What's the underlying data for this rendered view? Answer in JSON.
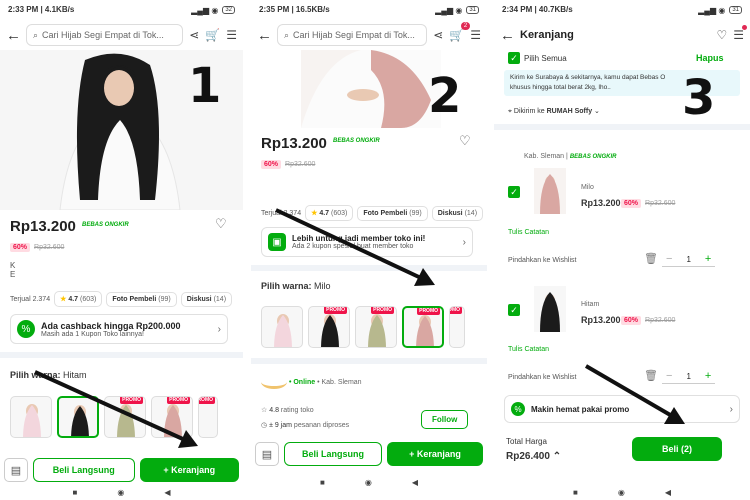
{
  "panels": [
    {
      "status": {
        "time": "2:33 PM",
        "speed": "4.1KB/s",
        "battery": "32"
      },
      "search_placeholder": "Cari Hijab Segi Empat di Tok...",
      "step_number": "1",
      "price": "Rp13.200",
      "shipping_badge": "BEBAS ONGKIR",
      "discount_pct": "60%",
      "old_price": "Rp32.600",
      "sold": "Terjual 2.374",
      "rating": "4.7",
      "rating_count": "(603)",
      "photo_chip": "Foto Pembeli",
      "photo_count": "(99)",
      "discussion_chip": "Diskusi",
      "discussion_count": "(14)",
      "cashback_title": "Ada cashback hingga Rp200.000",
      "cashback_sub": "Masih ada 1 Kupon Toko lainnya!",
      "variant_label": "Pilih warna:",
      "variant_value": "Hitam",
      "promo": "PROMO",
      "buy_now": "Beli Langsung",
      "add_cart": "+ Keranjang"
    },
    {
      "status": {
        "time": "2:35 PM",
        "speed": "16.5KB/s",
        "battery": "31"
      },
      "search_placeholder": "Cari Hijab Segi Empat di Tok...",
      "cart_badge": "2",
      "step_number": "2",
      "price": "Rp13.200",
      "shipping_badge": "BEBAS ONGKIR",
      "discount_pct": "60%",
      "old_price": "Rp32.600",
      "sold": "Terjual 2.374",
      "rating": "4.7",
      "rating_count": "(603)",
      "photo_chip": "Foto Pembeli",
      "photo_count": "(99)",
      "discussion_chip": "Diskusi",
      "discussion_count": "(14)",
      "member_title": "Lebih untung jadi member toko ini!",
      "member_sub": "Ada 2 kupon spesial buat member toko",
      "variant_label": "Pilih warna:",
      "variant_value": "Milo",
      "promo": "PROMO",
      "online": "• Online",
      "location": "• Kab. Sleman",
      "shop_rating": "4.8",
      "shop_rating_label": "rating toko",
      "process_time": "± 9 jam",
      "process_label": "pesanan diproses",
      "follow": "Follow",
      "buy_now": "Beli Langsung",
      "add_cart": "+ Keranjang"
    },
    {
      "status": {
        "time": "2:34 PM",
        "speed": "40.7KB/s",
        "battery": "31"
      },
      "title": "Keranjang",
      "step_number": "3",
      "select_all": "Pilih Semua",
      "delete": "Hapus",
      "info_line1": "Kirim ke Surabaya & sekitarnya, kamu dapat Bebas O",
      "info_line2": "khusus hingga total berat 2kg, lho..",
      "ship_to_prefix": "Dikirim ke",
      "ship_to": "RUMAH Soffy",
      "shop_location": "Kab. Sleman",
      "shipping_badge": "BEBAS ONGKIR",
      "items": [
        {
          "variant": "Milo",
          "price": "Rp13.200",
          "discount": "60%",
          "old_price": "Rp32.600",
          "note": "Tulis Catatan",
          "wishlist": "Pindahkan ke Wishlist",
          "qty": "1"
        },
        {
          "variant": "Hitam",
          "price": "Rp13.200",
          "discount": "60%",
          "old_price": "Rp32.600",
          "note": "Tulis Catatan",
          "wishlist": "Pindahkan ke Wishlist",
          "qty": "1"
        }
      ],
      "promo_text": "Makin hemat pakai promo",
      "total_label": "Total Harga",
      "total": "Rp26.400",
      "buy": "Beli (2)"
    }
  ],
  "colors": {
    "accent": "#03ac0e",
    "discount_bg": "#ffdbe2",
    "discount_text": "#ef144a"
  }
}
